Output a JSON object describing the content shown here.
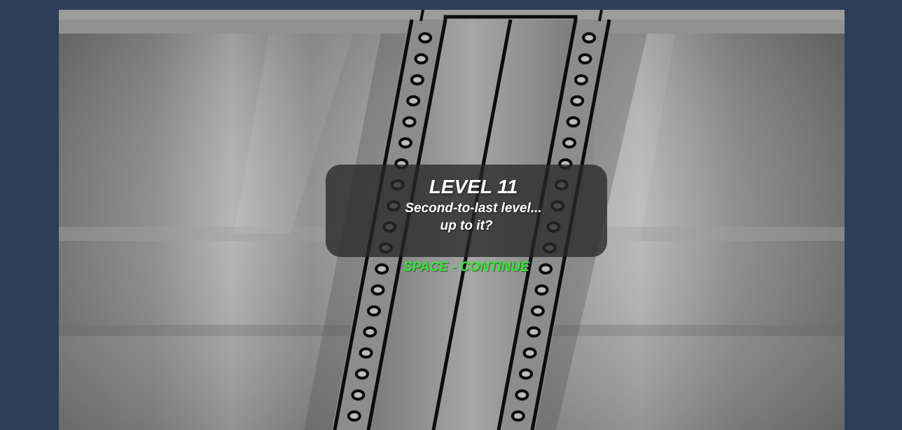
{
  "game": {
    "level_title": "LEVEL 11",
    "message_line1": "Second-to-last level...",
    "message_line2": "up to it?",
    "continue_prompt": "SPACE - CONTINUE"
  },
  "colors": {
    "page_background": "#2c3e5a",
    "overlay_background": "#282828",
    "text": "#ffffff",
    "prompt": "#2eea2e"
  },
  "icons": [
    "film-strip-track",
    "film-strip-hole"
  ]
}
